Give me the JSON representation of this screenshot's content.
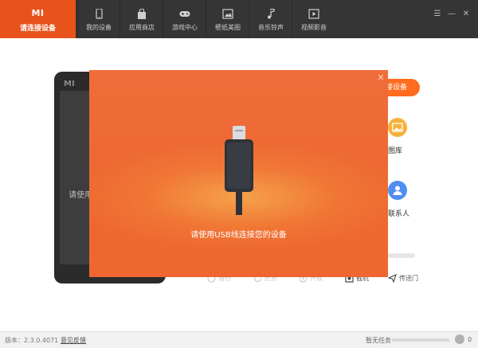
{
  "nav": {
    "connect": {
      "logo": "MI",
      "label": "请连接设备"
    },
    "tabs": [
      {
        "label": "我的设备",
        "icon": "phone-icon"
      },
      {
        "label": "应用商店",
        "icon": "bag-icon"
      },
      {
        "label": "游戏中心",
        "icon": "gamepad-icon"
      },
      {
        "label": "壁纸美图",
        "icon": "picture-icon"
      },
      {
        "label": "音乐铃声",
        "icon": "music-note-icon"
      },
      {
        "label": "视频影音",
        "icon": "video-icon"
      }
    ],
    "controls": {
      "menu": "☰",
      "minimize": "—",
      "close": "✕"
    }
  },
  "background": {
    "phone_logo": "MI",
    "phone_hint": "请使用",
    "connect_button": "接设备",
    "side_items": [
      {
        "label": "图库",
        "icon": "gallery-icon",
        "color": "#f7b23b"
      },
      {
        "label": "联系人",
        "icon": "contact-icon",
        "color": "#4f8ef0"
      }
    ],
    "tools": [
      {
        "label": "备份",
        "icon": "backup-icon",
        "enabled": false
      },
      {
        "label": "还原",
        "icon": "restore-icon",
        "enabled": false
      },
      {
        "label": "升级",
        "icon": "upgrade-icon",
        "enabled": false
      },
      {
        "label": "截机",
        "icon": "screenshot-icon",
        "enabled": true
      },
      {
        "label": "传送门",
        "icon": "send-icon",
        "enabled": true
      }
    ]
  },
  "dialog": {
    "message": "请使用USB线连接您的设备",
    "close": "✕",
    "colors": {
      "start": "#f5a24a",
      "end": "#ee6630"
    }
  },
  "status": {
    "version": "版本：2.3.0.4071",
    "feedback": "意见反馈",
    "task": "暂无任务",
    "count": "0"
  },
  "colors": {
    "accent": "#e8531c",
    "topbar": "#353535"
  }
}
